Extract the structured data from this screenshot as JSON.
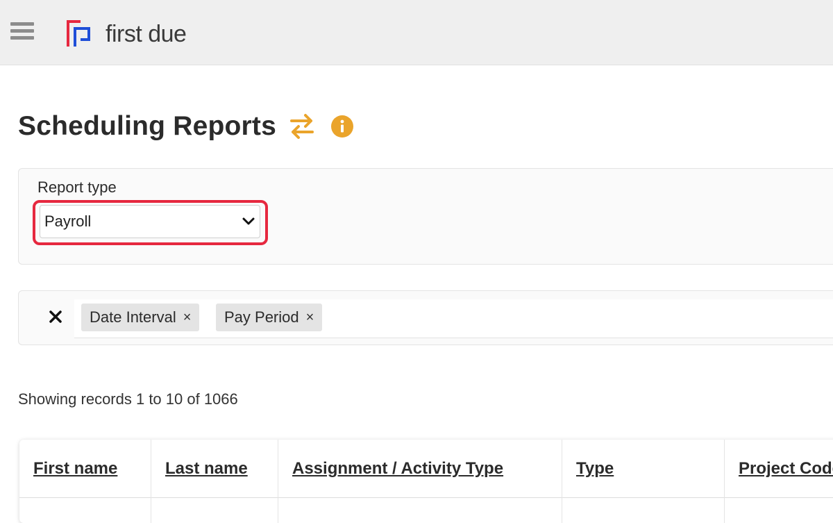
{
  "header": {
    "logo_text": "first due",
    "brand_colors": {
      "red": "#e6283f",
      "blue": "#1f4fd8"
    }
  },
  "page": {
    "title": "Scheduling Reports",
    "accent_color": "#eaa42b"
  },
  "report_type": {
    "label": "Report type",
    "selected": "Payroll"
  },
  "filters": {
    "chips": [
      {
        "label": "Date Interval",
        "remove": "×"
      },
      {
        "label": "Pay Period",
        "remove": "×"
      }
    ]
  },
  "records": {
    "summary": "Showing records 1 to 10 of 1066"
  },
  "table": {
    "columns": [
      "First name",
      "Last name",
      "Assignment / Activity Type",
      "Type",
      "Project Code"
    ]
  }
}
